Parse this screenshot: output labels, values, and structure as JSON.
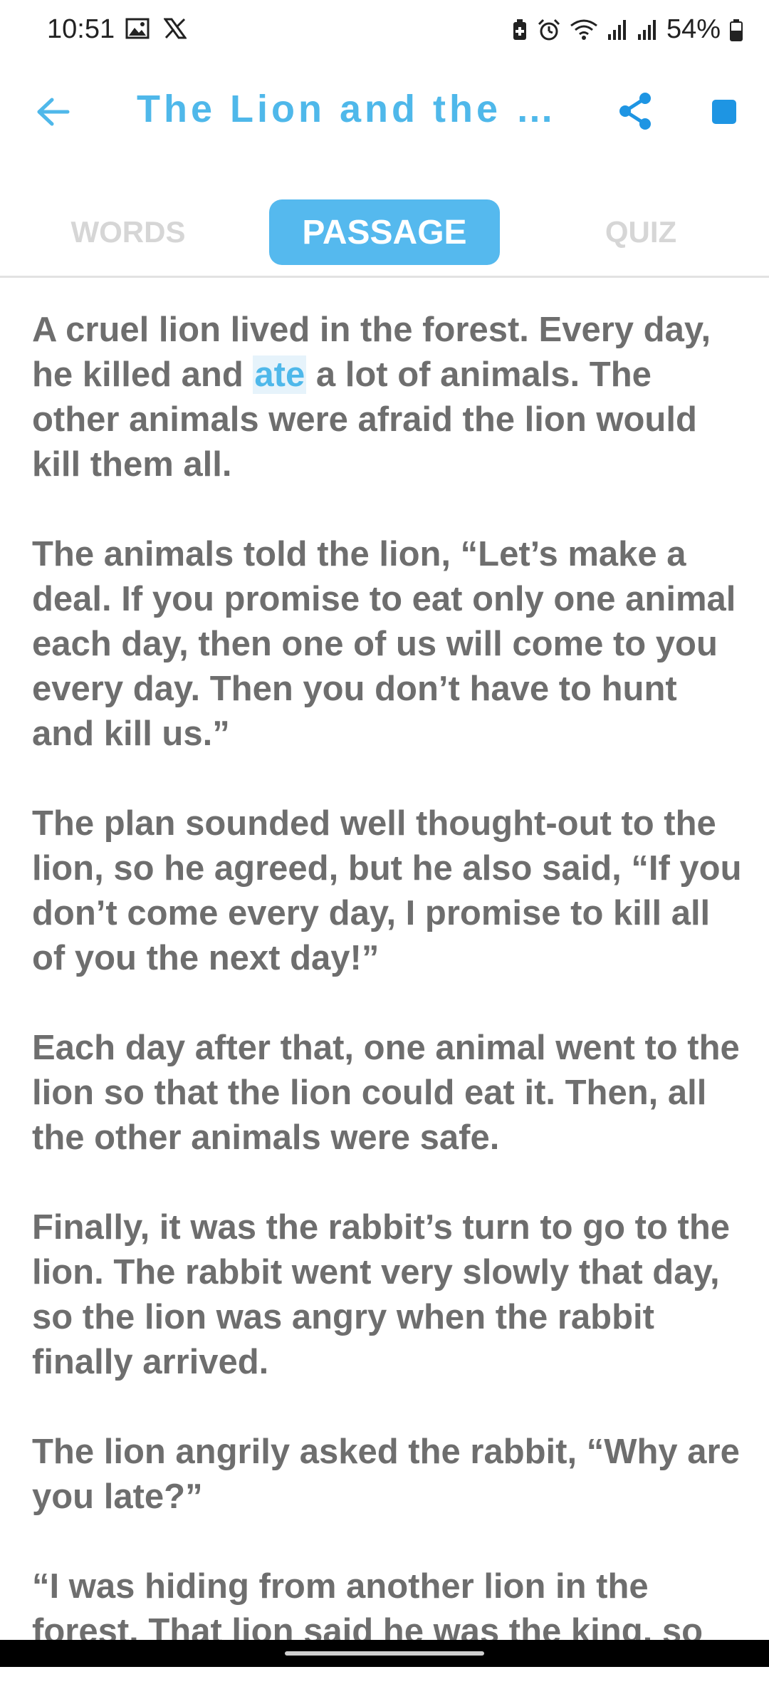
{
  "status_bar": {
    "time": "10:51",
    "battery": "54%",
    "icons": [
      "gallery-icon",
      "x-logo-icon",
      "battery-saver-icon",
      "alarm-icon",
      "wifi-icon",
      "signal-icon",
      "signal-icon",
      "battery-icon"
    ]
  },
  "app_bar": {
    "title": "The Lion and the R…",
    "back_icon": "arrow-left-icon",
    "share_icon": "share-icon",
    "stop_icon": "stop-icon"
  },
  "tabs": {
    "words": "WORDS",
    "passage": "PASSAGE",
    "quiz": "QUIZ",
    "active": "PASSAGE"
  },
  "passage": {
    "p1_before": "A cruel lion lived in the forest. Every day, he killed and ",
    "p1_highlight": "ate",
    "p1_after": " a lot of animals. The other animals were afraid the lion would kill them all.",
    "p2": "The animals told the lion, “Let’s make a deal. If you promise to eat only one animal each day, then one of us will come to you every day. Then you don’t have to hunt and kill us.”",
    "p3": "The plan sounded well thought-out to the lion, so he agreed, but he also said, “If you don’t come every day, I promise to kill all of you the next day!”",
    "p4": "Each day after that, one animal went to the lion so that the lion could eat it. Then, all the other animals were safe.",
    "p5": "Finally, it was the rabbit’s turn to go to the lion. The rabbit went very slowly that day, so the lion was angry when the rabbit finally arrived.",
    "p6": "The lion angrily asked the rabbit, “Why are you late?”",
    "p7": "“I was hiding from another lion in the forest. That lion said he was the king, so"
  },
  "colors": {
    "accent": "#4fb8ea",
    "tab_active_bg": "#55b9ee",
    "stop": "#1e95e3",
    "body_text": "#6e6e6e",
    "tab_inactive": "#d6d6d6"
  }
}
